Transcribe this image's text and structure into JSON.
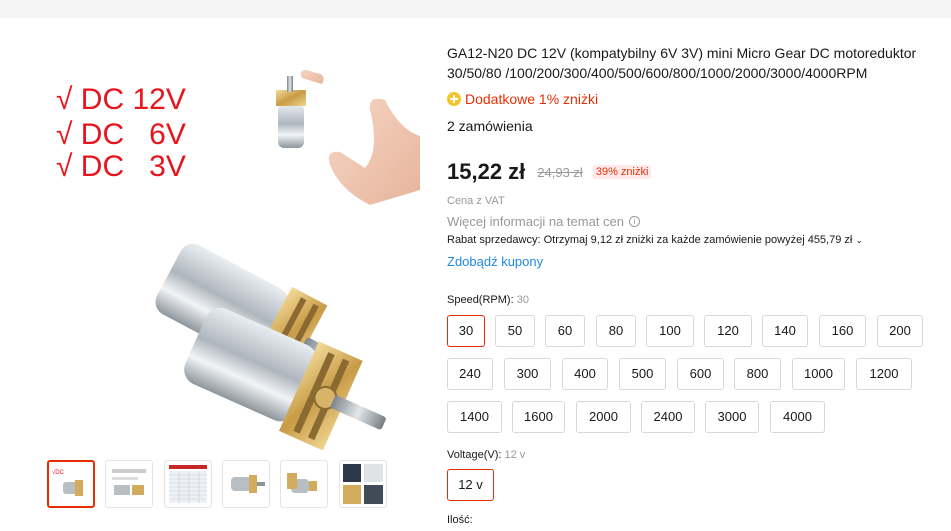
{
  "product": {
    "title": "GA12-N20 DC 12V (kompatybilny 6V 3V) mini Micro Gear DC motoreduktor 30/50/80 /100/200/300/400/500/600/800/1000/2000/3000/4000RPM",
    "bonus": "Dodatkowe 1% zniżki",
    "orders": "2 zamówienia",
    "price": "15,22 zł",
    "old_price": "24,93 zł",
    "discount": "39% zniżki",
    "vat": "Cena z VAT",
    "more_info": "Więcej informacji na temat cen",
    "seller_discount": "Rabat sprzedawcy: Otrzymaj 9,12 zł zniżki za każde zamówienie powyżej 455,79 zł",
    "coupon_link": "Zdobądź kupony"
  },
  "gallery": {
    "voltage_lines": [
      "√ DC 12V",
      "√ DC   6V",
      "√ DC   3V"
    ],
    "thumb_count": 6,
    "active_thumb": 0
  },
  "speed": {
    "label": "Speed(RPM):",
    "selected": "30",
    "options": [
      "30",
      "50",
      "60",
      "80",
      "100",
      "120",
      "140",
      "160",
      "200",
      "240",
      "300",
      "400",
      "500",
      "600",
      "800",
      "1000",
      "1200",
      "1400",
      "1600",
      "2000",
      "2400",
      "3000",
      "4000"
    ]
  },
  "voltage": {
    "label": "Voltage(V):",
    "selected": "12 v",
    "options": [
      "12 v"
    ]
  },
  "quantity": {
    "label": "Ilość:"
  },
  "colors": {
    "accent": "#e62e04",
    "link": "#1e88e5",
    "volt_text": "#e8141b"
  }
}
